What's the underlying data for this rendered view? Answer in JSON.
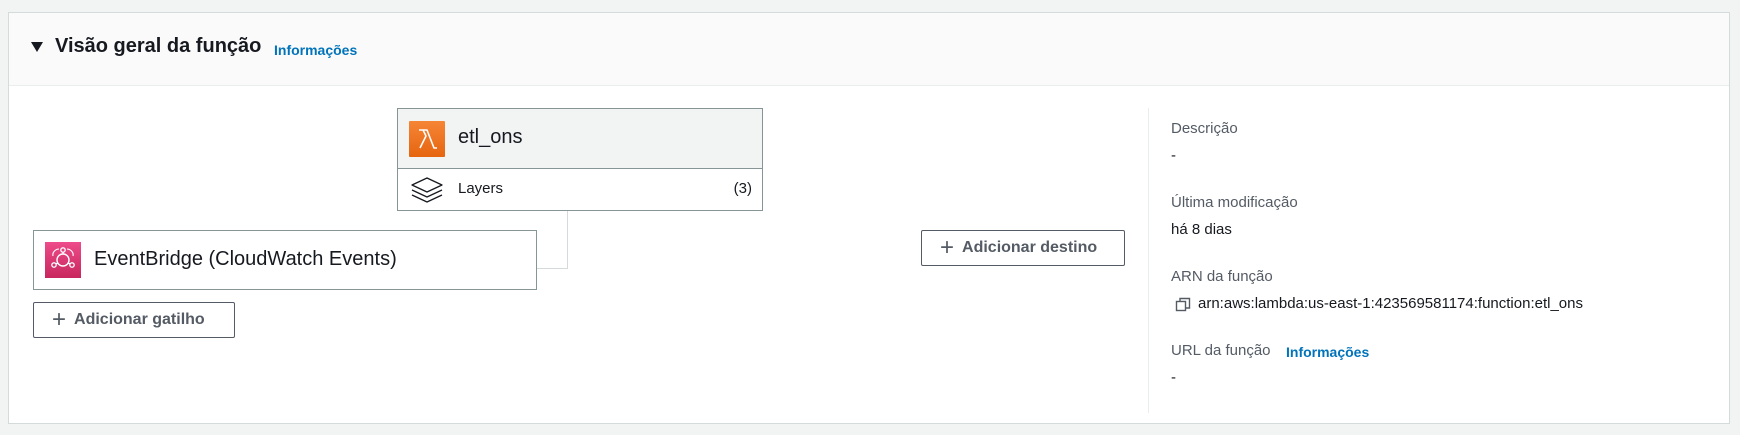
{
  "header": {
    "title": "Visão geral da função",
    "info_link": "Informações"
  },
  "function": {
    "name": "etl_ons",
    "layers_label": "Layers",
    "layers_count": "(3)"
  },
  "trigger": {
    "name": "EventBridge (CloudWatch Events)"
  },
  "buttons": {
    "add_trigger": "Adicionar gatilho",
    "add_destination": "Adicionar destino"
  },
  "properties": {
    "description_label": "Descrição",
    "description_value": "-",
    "last_modified_label": "Última modificação",
    "last_modified_value": "há 8 dias",
    "arn_label": "ARN da função",
    "arn_value": "arn:aws:lambda:us-east-1:423569581174:function:etl_ons",
    "url_label": "URL da função",
    "url_info_link": "Informações",
    "url_value": "-"
  },
  "icons": {
    "collapse": "caret-down-icon",
    "lambda": "lambda-icon",
    "layers": "layers-icon",
    "eventbridge": "eventbridge-icon",
    "add": "plus-icon",
    "copy": "copy-icon"
  },
  "colors": {
    "lambda_orange": "#e6650f",
    "eventbridge_pink": "#c8265d",
    "link_blue": "#0073bb"
  }
}
